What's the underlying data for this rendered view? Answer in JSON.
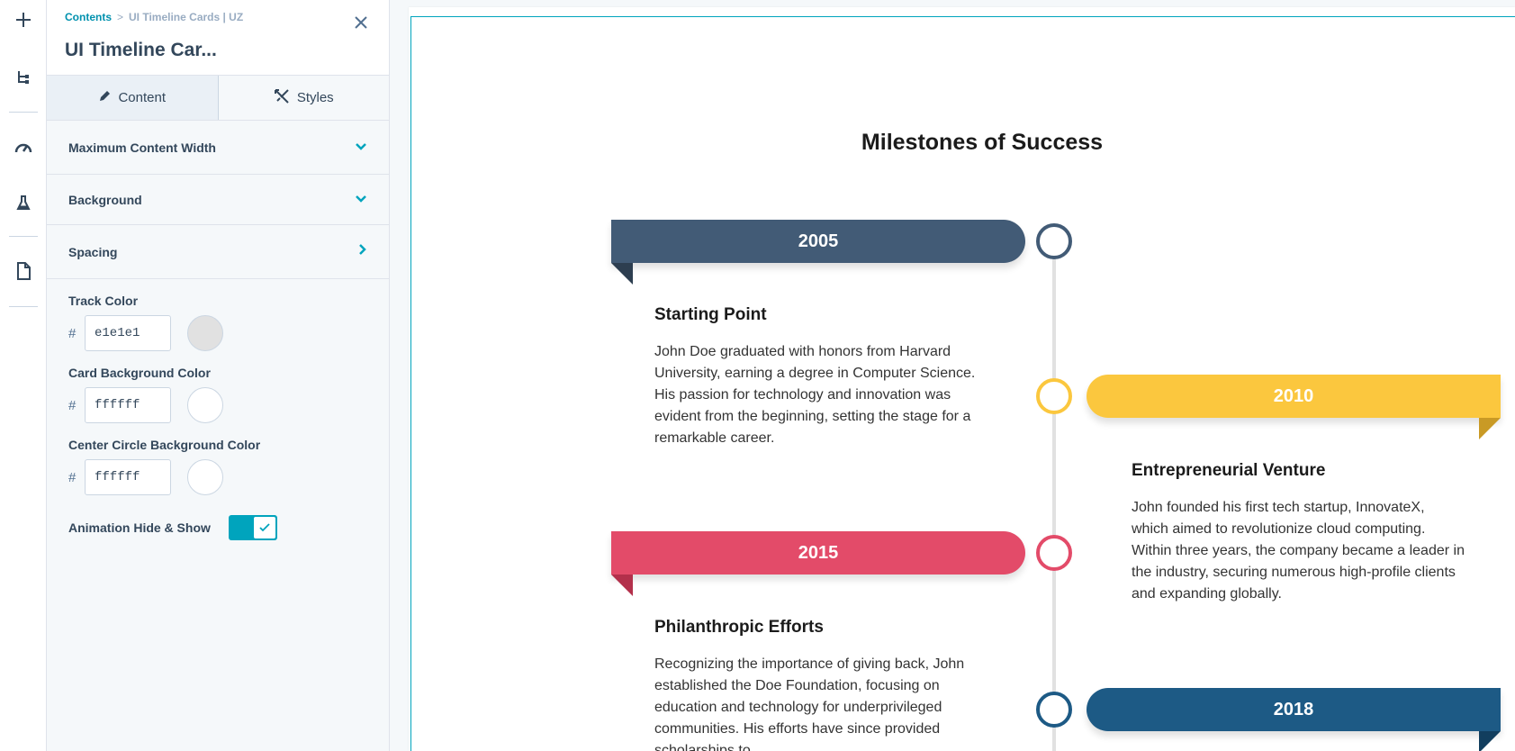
{
  "rail": {
    "items": [
      "add-icon",
      "tree-icon",
      "gauge-icon",
      "flask-icon",
      "page-icon"
    ]
  },
  "panel": {
    "breadcrumb": {
      "root": "Contents",
      "separator": ">",
      "current": "UI Timeline Cards | UZ"
    },
    "title": "UI Timeline Car...",
    "tabs": [
      {
        "label": "Content",
        "icon": "pencil-icon"
      },
      {
        "label": "Styles",
        "icon": "styles-icon"
      }
    ],
    "sections": [
      {
        "label": "Maximum Content Width",
        "chevron": "down"
      },
      {
        "label": "Background",
        "chevron": "down"
      },
      {
        "label": "Spacing",
        "chevron": "right"
      }
    ],
    "fields": {
      "track_color": {
        "label": "Track Color",
        "hash": "#",
        "value": "e1e1e1",
        "swatch": "#e1e1e1"
      },
      "card_bg_color": {
        "label": "Card Background Color",
        "hash": "#",
        "value": "ffffff",
        "swatch": "#ffffff"
      },
      "circle_bg_color": {
        "label": "Center Circle Background Color",
        "hash": "#",
        "value": "ffffff",
        "swatch": "#ffffff"
      }
    },
    "animation_toggle": {
      "label": "Animation Hide & Show",
      "on": true
    }
  },
  "timeline": {
    "title": "Milestones of Success",
    "track_color": "#e1e1e1",
    "items": [
      {
        "year": "2005",
        "color": "#425b76",
        "fold_color": "#2d3e50",
        "side": "left",
        "title": "Starting Point",
        "text": "John Doe graduated with honors from Harvard University, earning a degree in Computer Science. His passion for technology and innovation was evident from the beginning, setting the stage for a remarkable career."
      },
      {
        "year": "2010",
        "color": "#fbc73e",
        "fold_color": "#c99a25",
        "side": "right",
        "title": "Entrepreneurial Venture",
        "text": "John founded his first tech startup, InnovateX, which aimed to revolutionize cloud computing. Within three years, the company became a leader in the industry, securing numerous high-profile clients and expanding globally."
      },
      {
        "year": "2015",
        "color": "#e34b69",
        "fold_color": "#b3304b",
        "side": "left",
        "title": "Philanthropic Efforts",
        "text": "Recognizing the importance of giving back, John established the Doe Foundation, focusing on education and technology for underprivileged communities. His efforts have since provided scholarships to"
      },
      {
        "year": "2018",
        "color": "#1d5a85",
        "fold_color": "#123e5e",
        "side": "right",
        "title": "",
        "text": ""
      }
    ]
  }
}
